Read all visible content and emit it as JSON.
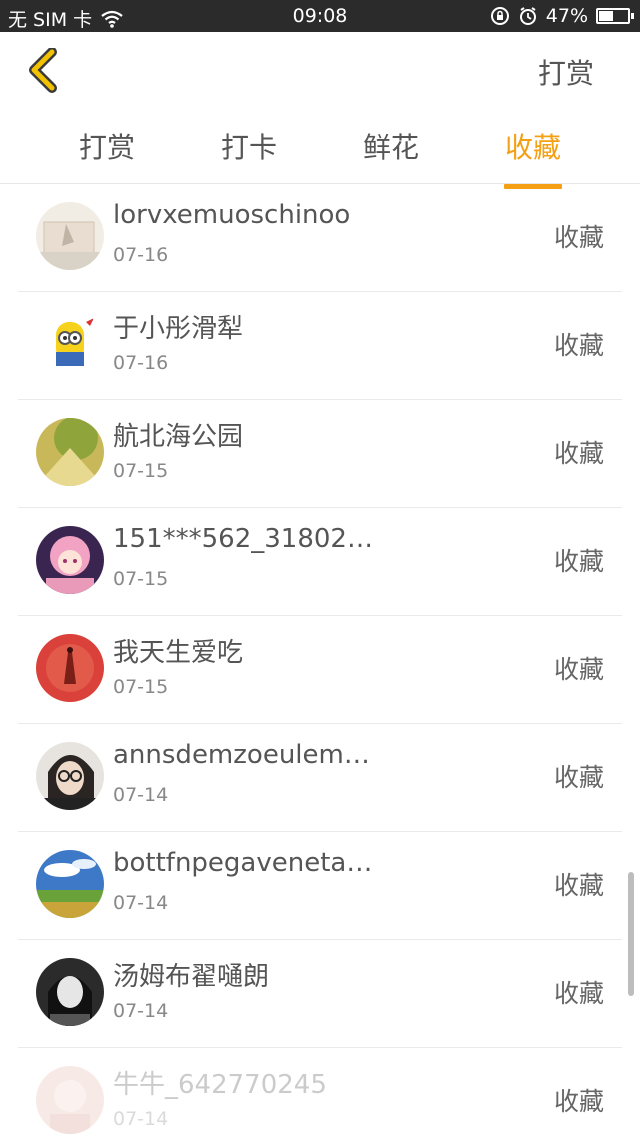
{
  "status_bar": {
    "carrier": "无 SIM 卡",
    "time": "09:08",
    "battery_level_percent": 47,
    "battery_text": "47%"
  },
  "header": {
    "action_label": "打赏"
  },
  "tabs": [
    {
      "label": "打赏",
      "active": false
    },
    {
      "label": "打卡",
      "active": false
    },
    {
      "label": "鲜花",
      "active": false
    },
    {
      "label": "收藏",
      "active": true
    }
  ],
  "items": [
    {
      "name": "lorvxemuoschinoo",
      "date": "07-16",
      "action": "收藏"
    },
    {
      "name": "于小彤滑犁",
      "date": "07-16",
      "action": "收藏"
    },
    {
      "name": "航北海公园",
      "date": "07-15",
      "action": "收藏"
    },
    {
      "name": "151***562_31802…",
      "date": "07-15",
      "action": "收藏"
    },
    {
      "name": "我天生爱吃",
      "date": "07-15",
      "action": "收藏"
    },
    {
      "name": "annsdemzoeulem…",
      "date": "07-14",
      "action": "收藏"
    },
    {
      "name": "bottfnpegaveneta…",
      "date": "07-14",
      "action": "收藏"
    },
    {
      "name": "汤姆布翟嗵朗",
      "date": "07-14",
      "action": "收藏"
    },
    {
      "name": "牛牛_642770245",
      "date": "07-14",
      "action": "收藏"
    }
  ],
  "colors": {
    "accent": "#f5a014",
    "back_icon": "#f2c200"
  }
}
